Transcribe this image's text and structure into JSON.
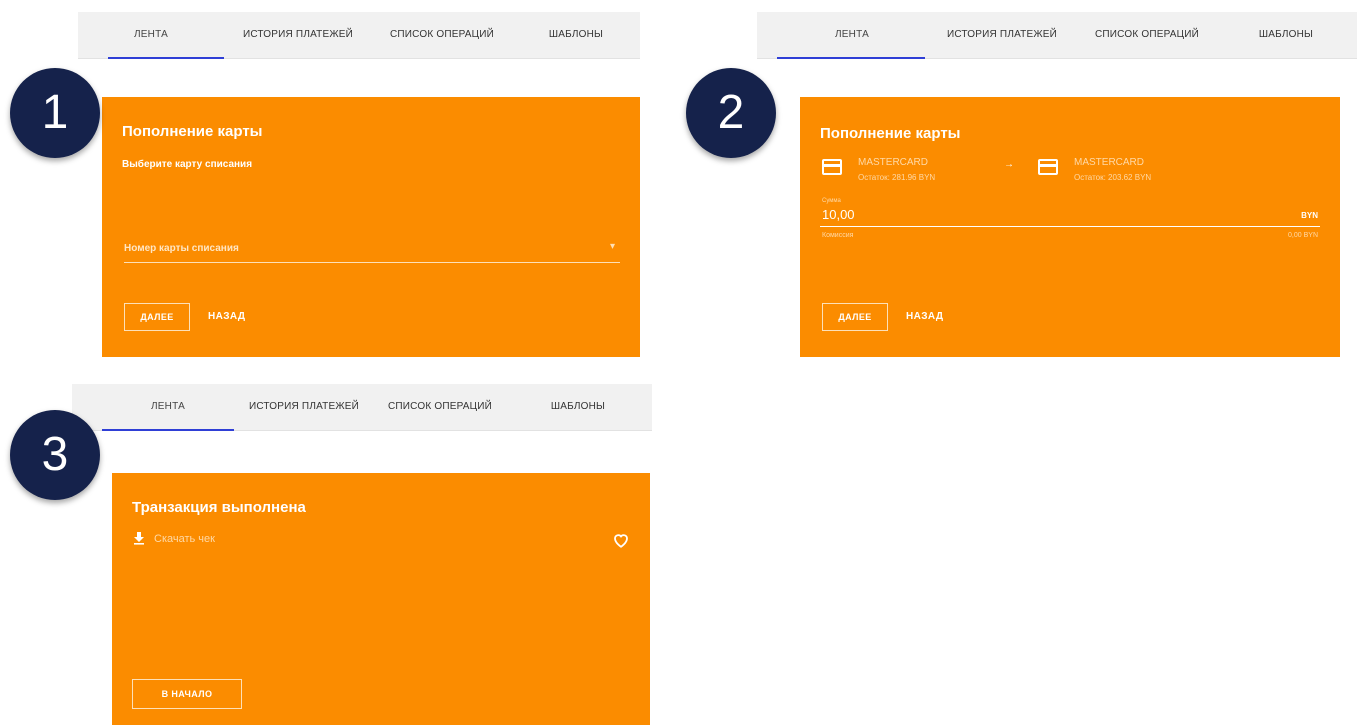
{
  "tabs": {
    "feed": "ЛЕНТА",
    "payment_history": "ИСТОРИЯ ПЛАТЕЖЕЙ",
    "operations_list": "СПИСОК ОПЕРАЦИЙ",
    "templates": "ШАБЛОНЫ"
  },
  "steps": {
    "one": "1",
    "two": "2",
    "three": "3"
  },
  "panel1": {
    "title": "Пополнение карты",
    "subtitle": "Выберите карту списания",
    "field_label": "Номер карты списания",
    "next": "ДАЛЕЕ",
    "back": "НАЗАД"
  },
  "panel2": {
    "title": "Пополнение карты",
    "from_card": {
      "name": "MASTERCARD",
      "balance": "Остаток: 281.96 BYN"
    },
    "to_card": {
      "name": "MASTERCARD",
      "balance": "Остаток: 203.62 BYN"
    },
    "arrow": "→",
    "amount_label": "Сумма",
    "amount": "10,00",
    "currency": "BYN",
    "commission_label": "Комиссия",
    "commission": "0,00 BYN",
    "next": "ДАЛЕЕ",
    "back": "НАЗАД"
  },
  "panel3": {
    "title": "Транзакция выполнена",
    "download": "Скачать чек",
    "to_start": "В НАЧАЛО"
  },
  "colors": {
    "accent": "#fb8c00",
    "tab_indicator": "#2f3fd6",
    "badge": "#15224b"
  }
}
